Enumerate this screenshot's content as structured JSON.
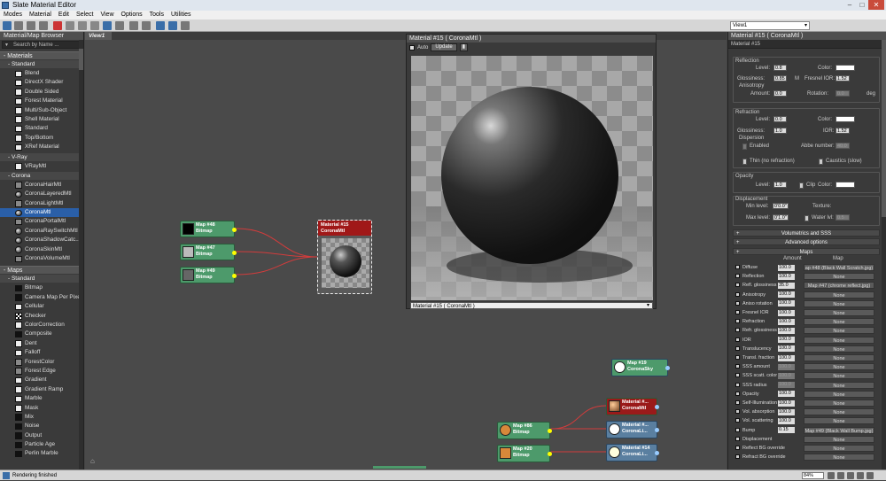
{
  "window": {
    "title": "Slate Material Editor"
  },
  "menu": [
    "Modes",
    "Material",
    "Edit",
    "Select",
    "View",
    "Options",
    "Tools",
    "Utilities"
  ],
  "toolbar": {
    "view_select": "View1"
  },
  "browser": {
    "title": "Material/Map Browser",
    "search_placeholder": "Search by Name ...",
    "sections": [
      {
        "label": "- Materials"
      },
      {
        "label": "- Standard"
      },
      {
        "label": "- V-Ray"
      },
      {
        "label": "- Corona"
      },
      {
        "label": "- Maps"
      },
      {
        "label": "- Standard"
      }
    ],
    "standard_materials": [
      "Blend",
      "DirectX Shader",
      "Double Sided",
      "Forest Material",
      "Multi/Sub-Object",
      "Shell Material",
      "Standard",
      "Top/Bottom",
      "XRef Material"
    ],
    "vray_materials": [
      "VRayMtl"
    ],
    "corona_materials": [
      "CoronaHairMtl",
      "CoronaLayeredMtl",
      "CoronaLightMtl",
      "CoronaMtl",
      "CoronaPortalMtl",
      "CoronaRaySwitchMtl",
      "CoronaShadowCatc...",
      "CoronaSkinMtl",
      "CoronaVolumeMtl"
    ],
    "selected_material": "CoronaMtl",
    "standard_maps": [
      "Bitmap",
      "Camera Map Per Pixel",
      "Cellular",
      "Checker",
      "ColorCorrection",
      "Composite",
      "Dent",
      "Falloff",
      "ForestColor",
      "Forest Edge",
      "Gradient",
      "Gradient Ramp",
      "Marble",
      "Mask",
      "Mix",
      "Noise",
      "Output",
      "Particle Age",
      "Perlin Marble"
    ]
  },
  "view": {
    "tab": "View1",
    "nodes": [
      {
        "name": "Map #48",
        "type": "Bitmap"
      },
      {
        "name": "Map #47",
        "type": "Bitmap"
      },
      {
        "name": "Map #49",
        "type": "Bitmap"
      },
      {
        "name": "Map #19",
        "type": "CoronaSky"
      },
      {
        "name": "Map #86",
        "type": "Bitmap"
      },
      {
        "name": "Map #20",
        "type": "Bitmap"
      },
      {
        "name": "Material #...",
        "type": "CoronaMtl"
      },
      {
        "name": "Material #...",
        "type": "CoronaLi..."
      },
      {
        "name": "Material #14",
        "type": "CoronaLi..."
      }
    ],
    "material_node": {
      "name": "Material #15",
      "type": "CoronaMtl"
    }
  },
  "preview": {
    "title": "Material #15  ( CoronaMtl )",
    "auto_label": "Auto",
    "update_label": "Update",
    "select_value": "Material #15  ( CoronaMtl )"
  },
  "params": {
    "title": "Material #15  ( CoronaMtl )",
    "material_name": "Material #15",
    "reflection": {
      "group": "Reflection",
      "level_label": "Level:",
      "level": "0.8",
      "color_label": "Color:",
      "gloss_label": "Glossiness:",
      "gloss": "0.85",
      "m_label": "M",
      "fresnel_label": "Fresnel IOR:",
      "fresnel": "1.52",
      "aniso_label": "Anisotropy",
      "amount_label": "Amount:",
      "amount": "0.0",
      "rotation_label": "Rotation:",
      "rotation": "0.0",
      "deg": "deg"
    },
    "refraction": {
      "group": "Refraction",
      "level_label": "Level:",
      "level": "0.0",
      "color_label": "Color:",
      "gloss_label": "Glossiness:",
      "gloss": "1.0",
      "ior_label": "IOR:",
      "ior": "1.52",
      "dispersion_label": "Dispersion",
      "enabled_label": "Enabled",
      "abbe_label": "Abbe number:",
      "abbe": "40.0",
      "thin_label": "Thin (no refraction)",
      "caustics_label": "Caustics (slow)"
    },
    "opacity": {
      "group": "Opacity",
      "level_label": "Level:",
      "level": "1.0",
      "clip_label": "Clip",
      "color_label": "Color:"
    },
    "displacement": {
      "group": "Displacement",
      "min_label": "Min level:",
      "min": "0'0.0\"",
      "texture_label": "Texture:",
      "max_label": "Max level:",
      "max": "0'1.0\"",
      "water_label": "Water lvl:",
      "water": "0.5"
    },
    "rollouts": [
      "Volumetrics and SSS",
      "Advanced options",
      "Maps"
    ],
    "maps_header": {
      "amount": "Amount",
      "map": "Map"
    },
    "maps": [
      {
        "name": "Diffuse",
        "amount": "100.0",
        "map": "ap #48 (Black Wall Scratch.jpg)"
      },
      {
        "name": "Reflection",
        "amount": "100.0",
        "map": "None"
      },
      {
        "name": "Refl. glossiness",
        "amount": "35.0",
        "map": "Map #47 (chrome reflect.jpg)"
      },
      {
        "name": "Anisotropy",
        "amount": "100.0",
        "map": "None"
      },
      {
        "name": "Aniso rotation",
        "amount": "100.0",
        "map": "None"
      },
      {
        "name": "Fresnel IOR",
        "amount": "100.0",
        "map": "None"
      },
      {
        "name": "Refraction",
        "amount": "100.0",
        "map": "None"
      },
      {
        "name": "Refr. glossiness",
        "amount": "100.0",
        "map": "None"
      },
      {
        "name": "IOR",
        "amount": "100.0",
        "map": "None"
      },
      {
        "name": "Translucency",
        "amount": "100.0",
        "map": "None"
      },
      {
        "name": "Transl. fraction",
        "amount": "100.0",
        "map": "None"
      },
      {
        "name": "SSS amount",
        "amount": "100.0",
        "map": "None"
      },
      {
        "name": "SSS scatt. color",
        "amount": "100.0",
        "map": "None"
      },
      {
        "name": "SSS radius",
        "amount": "100.0",
        "map": "None"
      },
      {
        "name": "Opacity",
        "amount": "100.0",
        "map": "None"
      },
      {
        "name": "Self-Illumination",
        "amount": "100.0",
        "map": "None"
      },
      {
        "name": "Vol. absorption",
        "amount": "100.0",
        "map": "None"
      },
      {
        "name": "Vol. scattering",
        "amount": "100.0",
        "map": "None"
      },
      {
        "name": "Bump",
        "amount": "0.15",
        "map": "Map #49 (Black Wall Bump.jpg)"
      },
      {
        "name": "Displacement",
        "amount": "",
        "map": "None"
      },
      {
        "name": "Reflect BG override",
        "amount": "",
        "map": "None"
      },
      {
        "name": "Refract BG override",
        "amount": "",
        "map": "None"
      }
    ]
  },
  "status": {
    "text": "Rendering finished",
    "zoom": "84%"
  },
  "colors": {
    "map_node": "#4d9a6b",
    "material_header": "#a01818",
    "wire": "#d23c3c",
    "selection": "#2a5fa8"
  }
}
